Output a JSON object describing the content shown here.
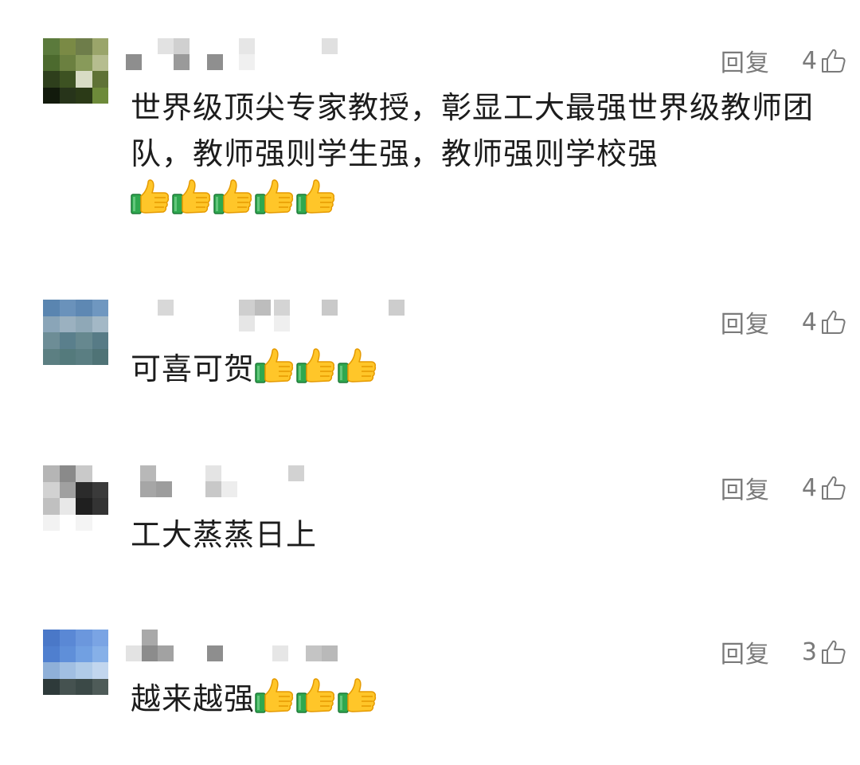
{
  "comments": [
    {
      "reply_label": "回复",
      "likes": "4",
      "text": "世界级顶尖专家教授，彰显工大最强世界级教师团队，教师强则学生强，教师强则学校强",
      "thumbs_emoji_count": 5,
      "avatar_colors": [
        "#5b7a3c",
        "#7a8a45",
        "#6e7d4a",
        "#9aa56a",
        "#4c6a2e",
        "#6b8040",
        "#889a5a",
        "#b6bd8f",
        "#2e3f1c",
        "#3d5222",
        "#d8dcc5",
        "#5f7236",
        "#121a0c",
        "#27341a",
        "#2b3a17",
        "#6d8a3a"
      ]
    },
    {
      "reply_label": "回复",
      "likes": "4",
      "text": "可喜可贺",
      "thumbs_emoji_count": 3,
      "avatar_colors": [
        "#5a85b0",
        "#6a92bb",
        "#5e88b3",
        "#6f97c0",
        "#8aa5b8",
        "#9bb1c0",
        "#8fa8b7",
        "#a3b8c6",
        "#6d8d96",
        "#5a7f8c",
        "#66888f",
        "#577b86",
        "#5c7f82",
        "#547a7c",
        "#5a7e82",
        "#4f7376"
      ]
    },
    {
      "reply_label": "回复",
      "likes": "4",
      "text": "工大蒸蒸日上",
      "thumbs_emoji_count": 0,
      "avatar_colors": [
        "#b5b5b5",
        "#8a8a8a",
        "#c9c9c9",
        "#ffffff",
        "#d2d2d2",
        "#a0a0a0",
        "#2b2b2b",
        "#3a3a3a",
        "#c0c0c0",
        "#e8e8e8",
        "#1f1f1f",
        "#333333",
        "#f2f2f2",
        "#ffffff",
        "#f4f4f4",
        "#ffffff"
      ]
    },
    {
      "reply_label": "回复",
      "likes": "3",
      "text": "越来越强",
      "thumbs_emoji_count": 3,
      "avatar_colors": [
        "#4a78c8",
        "#5a88d5",
        "#6b97dd",
        "#7aa4e4",
        "#4f7fcf",
        "#5f8fd9",
        "#71a0e2",
        "#86b0e8",
        "#8fb0d8",
        "#a1bfe2",
        "#b0cbe8",
        "#c2d6ee",
        "#2e3a3a",
        "#455250",
        "#3b4947",
        "#4e5b58"
      ]
    }
  ],
  "colors": {
    "text": "#1c1c1c",
    "meta": "#7a7a7a",
    "background": "#ffffff"
  },
  "icons": {
    "like": "thumbs-up-outline-icon",
    "emoji": "thumbs-up-emoji"
  }
}
